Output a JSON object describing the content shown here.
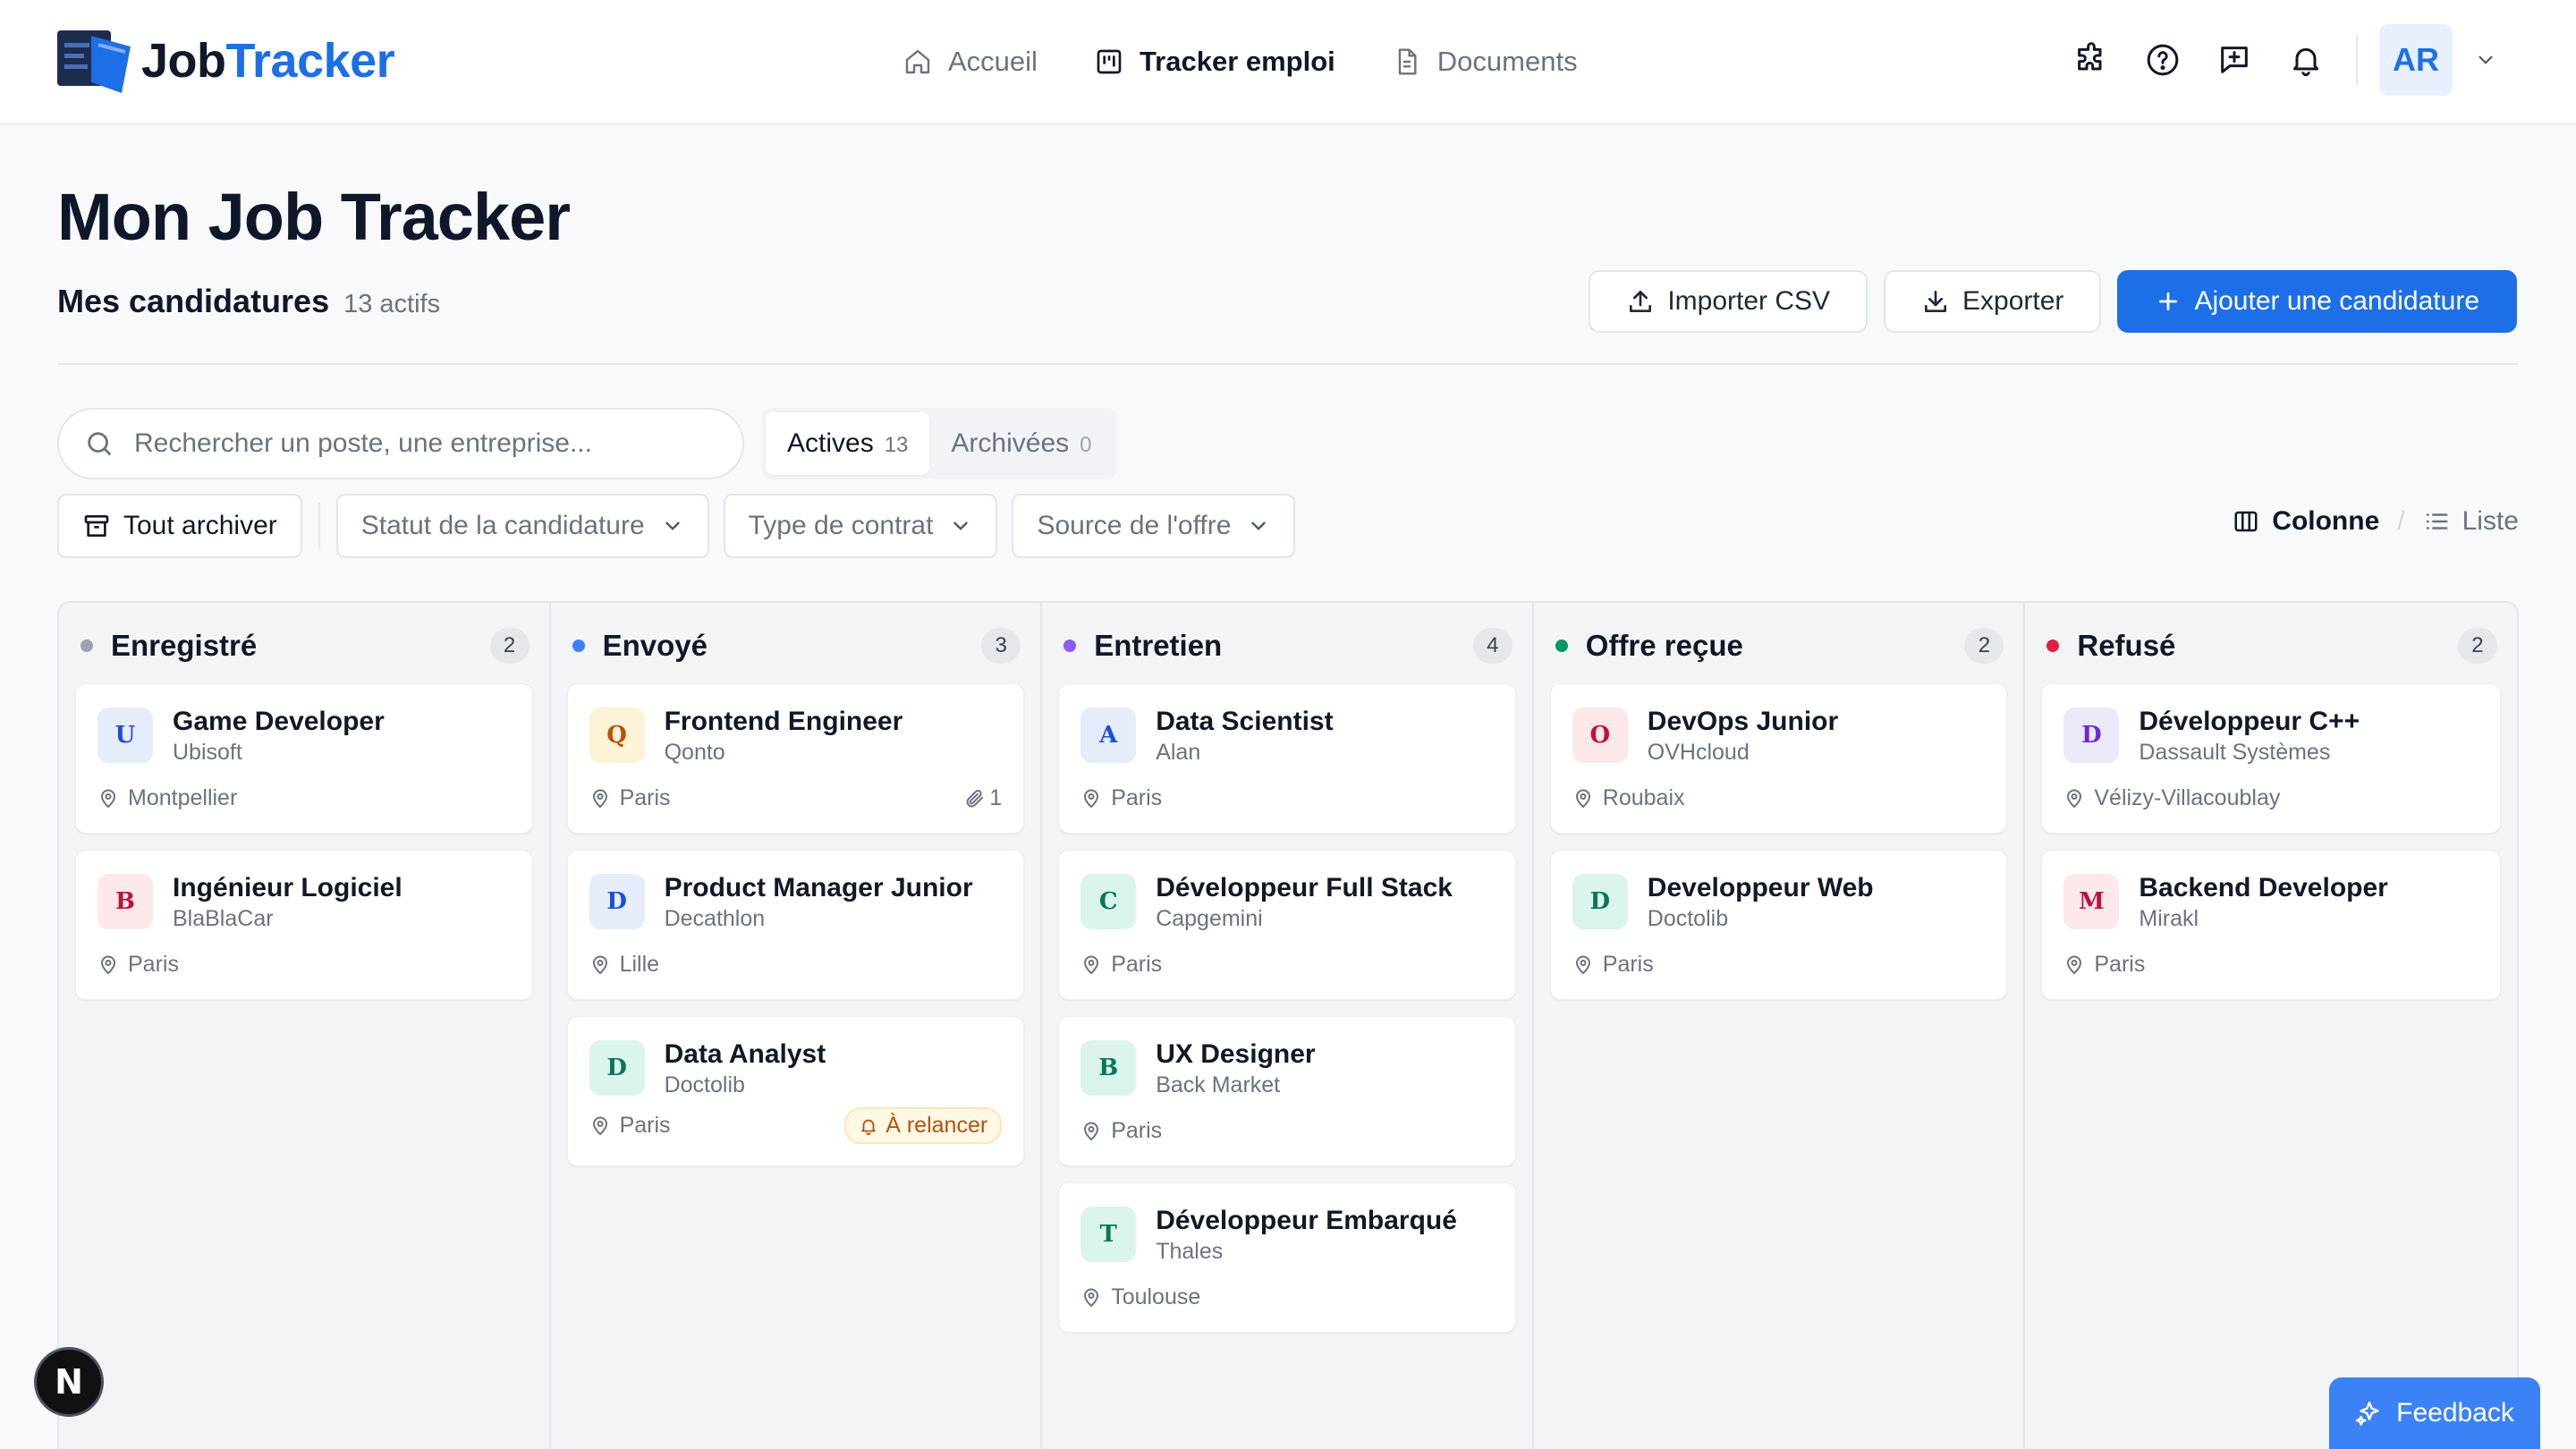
{
  "app": {
    "logo_part1": "Job",
    "logo_part2": "Tracker",
    "brand_color": "#1d6fe8"
  },
  "nav": {
    "home": "Accueil",
    "tracker": "Tracker emploi",
    "documents": "Documents"
  },
  "user": {
    "initials": "AR"
  },
  "page": {
    "title": "Mon Job Tracker",
    "subtitle": "Mes candidatures",
    "count": "13 actifs"
  },
  "actions": {
    "import": "Importer CSV",
    "export": "Exporter",
    "add": "Ajouter une candidature"
  },
  "search": {
    "placeholder": "Rechercher un poste, une entreprise..."
  },
  "tabs": {
    "active_label": "Actives",
    "active_count": "13",
    "archived_label": "Archivées",
    "archived_count": "0"
  },
  "filters": {
    "archive_all": "Tout archiver",
    "status": "Statut de la candidature",
    "contract": "Type de contrat",
    "source": "Source de l'offre"
  },
  "view": {
    "column": "Colonne",
    "separator": "/",
    "list": "Liste"
  },
  "columns": [
    {
      "title": "Enregistré",
      "count": "2",
      "dot": "#9ca3af",
      "cards": [
        {
          "initial": "U",
          "title": "Game Developer",
          "company": "Ubisoft",
          "location": "Montpellier",
          "badge_bg": "#e5edfb",
          "badge_fg": "#1d4ed8"
        },
        {
          "initial": "B",
          "title": "Ingénieur Logiciel",
          "company": "BlaBlaCar",
          "location": "Paris",
          "badge_bg": "#fde8ea",
          "badge_fg": "#be123c"
        }
      ]
    },
    {
      "title": "Envoyé",
      "count": "3",
      "dot": "#3b82f6",
      "cards": [
        {
          "initial": "Q",
          "title": "Frontend Engineer",
          "company": "Qonto",
          "location": "Paris",
          "attachments": "1",
          "badge_bg": "#fdf3d6",
          "badge_fg": "#b45309"
        },
        {
          "initial": "D",
          "title": "Product Manager Junior",
          "company": "Decathlon",
          "location": "Lille",
          "badge_bg": "#e5edfb",
          "badge_fg": "#1d4ed8"
        },
        {
          "initial": "D",
          "title": "Data Analyst",
          "company": "Doctolib",
          "location": "Paris",
          "reminder": "À relancer",
          "badge_bg": "#dcf5ec",
          "badge_fg": "#047857"
        }
      ]
    },
    {
      "title": "Entretien",
      "count": "4",
      "dot": "#8b5cf6",
      "cards": [
        {
          "initial": "A",
          "title": "Data Scientist",
          "company": "Alan",
          "location": "Paris",
          "badge_bg": "#e5edfb",
          "badge_fg": "#1d4ed8"
        },
        {
          "initial": "C",
          "title": "Développeur Full Stack",
          "company": "Capgemini",
          "location": "Paris",
          "badge_bg": "#dcf5ec",
          "badge_fg": "#047857"
        },
        {
          "initial": "B",
          "title": "UX Designer",
          "company": "Back Market",
          "location": "Paris",
          "badge_bg": "#dcf5ec",
          "badge_fg": "#047857"
        },
        {
          "initial": "T",
          "title": "Développeur Embarqué",
          "company": "Thales",
          "location": "Toulouse",
          "badge_bg": "#dcf5ec",
          "badge_fg": "#047857"
        }
      ]
    },
    {
      "title": "Offre reçue",
      "count": "2",
      "dot": "#059669",
      "cards": [
        {
          "initial": "O",
          "title": "DevOps Junior",
          "company": "OVHcloud",
          "location": "Roubaix",
          "badge_bg": "#fde8ea",
          "badge_fg": "#be123c"
        },
        {
          "initial": "D",
          "title": "Developpeur Web",
          "company": "Doctolib",
          "location": "Paris",
          "badge_bg": "#dcf5ec",
          "badge_fg": "#047857"
        }
      ]
    },
    {
      "title": "Refusé",
      "count": "2",
      "dot": "#e11d48",
      "cards": [
        {
          "initial": "D",
          "title": "Développeur C++",
          "company": "Dassault Systèmes",
          "location": "Vélizy-Villacoublay",
          "badge_bg": "#ece9fb",
          "badge_fg": "#6d28d9"
        },
        {
          "initial": "M",
          "title": "Backend Developer",
          "company": "Mirakl",
          "location": "Paris",
          "badge_bg": "#fde8ea",
          "badge_fg": "#be123c"
        }
      ]
    }
  ],
  "floating": {
    "dev_badge": "N",
    "feedback": "Feedback"
  }
}
